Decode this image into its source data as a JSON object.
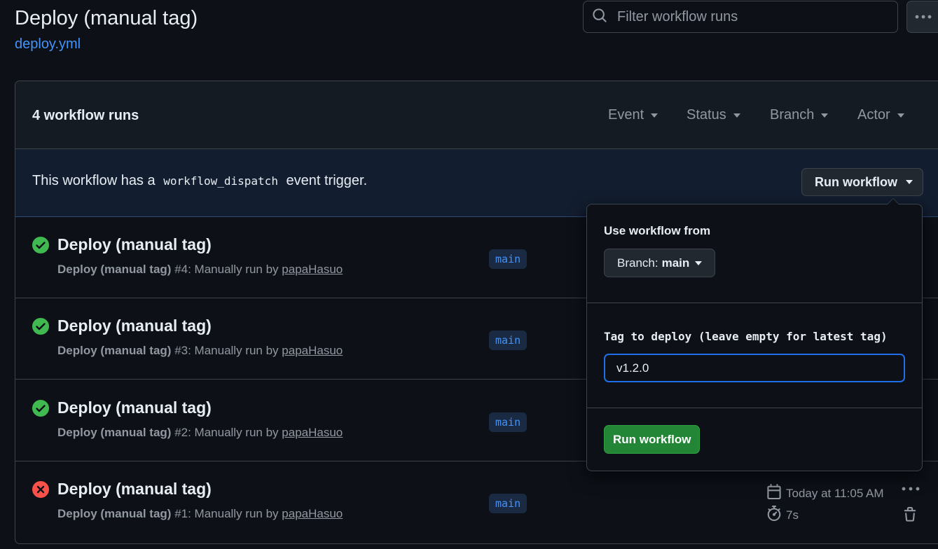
{
  "header": {
    "title": "Deploy (manual tag)",
    "file_link": "deploy.yml",
    "filter_placeholder": "Filter workflow runs"
  },
  "runs_header": {
    "count_label": "4 workflow runs",
    "filters": [
      "Event",
      "Status",
      "Branch",
      "Actor"
    ]
  },
  "dispatch": {
    "text_before": "This workflow has a",
    "code": "workflow_dispatch",
    "text_after": "event trigger.",
    "run_button": "Run workflow"
  },
  "runs": [
    {
      "status": "success",
      "title": "Deploy (manual tag)",
      "meta_bold": "Deploy (manual tag)",
      "meta_rest": " #4: Manually run by ",
      "actor": "papaHasuo",
      "branch": "main"
    },
    {
      "status": "success",
      "title": "Deploy (manual tag)",
      "meta_bold": "Deploy (manual tag)",
      "meta_rest": " #3: Manually run by ",
      "actor": "papaHasuo",
      "branch": "main"
    },
    {
      "status": "success",
      "title": "Deploy (manual tag)",
      "meta_bold": "Deploy (manual tag)",
      "meta_rest": " #2: Manually run by ",
      "actor": "papaHasuo",
      "branch": "main"
    },
    {
      "status": "failure",
      "title": "Deploy (manual tag)",
      "meta_bold": "Deploy (manual tag)",
      "meta_rest": " #1: Manually run by ",
      "actor": "papaHasuo",
      "branch": "main",
      "when": "Today at 11:05 AM",
      "duration": "7s"
    }
  ],
  "dropdown": {
    "use_from_label": "Use workflow from",
    "branch_prefix": "Branch:",
    "branch_value": "main",
    "input_label": "Tag to deploy (leave empty for latest tag)",
    "input_value": "v1.2.0",
    "submit_label": "Run workflow"
  },
  "colors": {
    "background": "#0d1117",
    "success": "#3fb950",
    "failure": "#f85149",
    "link": "#4493f8",
    "primary_button": "#238636",
    "focus_border": "#1f6feb"
  },
  "icons": {
    "search": "search-icon",
    "kebab": "kebab-horizontal-icon",
    "success": "check-circle-fill-icon",
    "failure": "x-circle-fill-icon",
    "calendar": "calendar-icon",
    "stopwatch": "stopwatch-icon",
    "trash": "trash-icon",
    "caret": "triangle-down-icon"
  }
}
